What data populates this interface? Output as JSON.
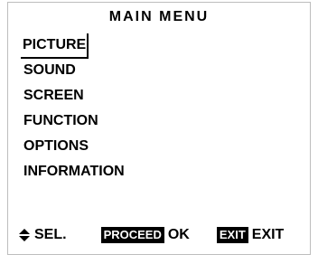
{
  "menu": {
    "title": "MAIN MENU",
    "items": [
      {
        "label": "PICTURE",
        "selected": true
      },
      {
        "label": "SOUND"
      },
      {
        "label": "SCREEN"
      },
      {
        "label": "FUNCTION"
      },
      {
        "label": "OPTIONS"
      },
      {
        "label": "INFORMATION"
      }
    ]
  },
  "footer": {
    "select_icon": "up-down-arrow-icon",
    "select_label": "SEL.",
    "proceed_key": "PROCEED",
    "proceed_label": "OK",
    "exit_key": "EXIT",
    "exit_label": "EXIT"
  }
}
